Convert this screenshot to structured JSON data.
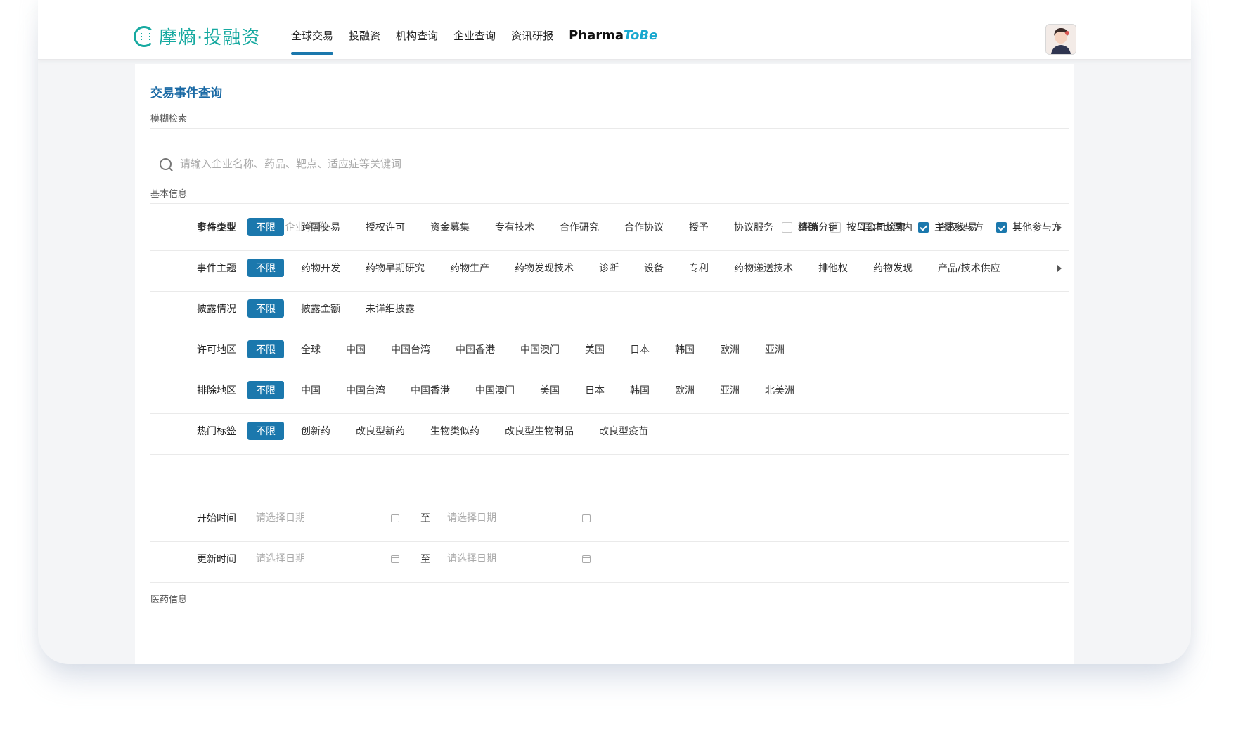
{
  "topbar": {
    "logo_text": "摩熵·投融资",
    "nav": [
      {
        "label": "全球交易",
        "active": true
      },
      {
        "label": "投融资"
      },
      {
        "label": "机构查询"
      },
      {
        "label": "企业查询"
      },
      {
        "label": "资讯研报"
      }
    ],
    "brand": {
      "part1": "Pharma",
      "part2": "ToBe"
    }
  },
  "page": {
    "title": "交易事件查询",
    "fuzzy_label": "模糊检索",
    "search_placeholder": "请输入企业名称、药品、靶点、适应症等关键词",
    "basic_label": "基本信息",
    "bottom_label": "医药信息"
  },
  "participants": {
    "label": "参与企业",
    "placeholder": "请输入企业名称",
    "checks": [
      {
        "label": "精确",
        "checked": false
      },
      {
        "label": "按母公司检索",
        "checked": false
      },
      {
        "label": "主要参与方",
        "checked": true
      },
      {
        "label": "其他参与方",
        "checked": true
      }
    ]
  },
  "filters": [
    {
      "label": "事件类型",
      "selected": "不限",
      "options": [
        "跨国交易",
        "授权许可",
        "资金募集",
        "专有技术",
        "合作研究",
        "合作协议",
        "授予",
        "协议服务",
        "经销分销",
        "国内to国内",
        "含权交易"
      ],
      "more": true
    },
    {
      "label": "事件主题",
      "selected": "不限",
      "options": [
        "药物开发",
        "药物早期研究",
        "药物生产",
        "药物发现技术",
        "诊断",
        "设备",
        "专利",
        "药物递送技术",
        "排他权",
        "药物发现",
        "产品/技术供应"
      ],
      "more": true
    },
    {
      "label": "披露情况",
      "selected": "不限",
      "options": [
        "披露金额",
        "未详细披露"
      ],
      "more": false
    },
    {
      "label": "许可地区",
      "selected": "不限",
      "options": [
        "全球",
        "中国",
        "中国台湾",
        "中国香港",
        "中国澳门",
        "美国",
        "日本",
        "韩国",
        "欧洲",
        "亚洲"
      ],
      "more": false
    },
    {
      "label": "排除地区",
      "selected": "不限",
      "options": [
        "中国",
        "中国台湾",
        "中国香港",
        "中国澳门",
        "美国",
        "日本",
        "韩国",
        "欧洲",
        "亚洲",
        "北美洲"
      ],
      "more": false
    },
    {
      "label": "热门标签",
      "selected": "不限",
      "options": [
        "创新药",
        "改良型新药",
        "生物类似药",
        "改良型生物制品",
        "改良型疫苗"
      ],
      "more": false
    }
  ],
  "dates": [
    {
      "label": "开始时间",
      "from_placeholder": "请选择日期",
      "sep": "至",
      "to_placeholder": "请选择日期"
    },
    {
      "label": "更新时间",
      "from_placeholder": "请选择日期",
      "sep": "至",
      "to_placeholder": "请选择日期"
    }
  ]
}
